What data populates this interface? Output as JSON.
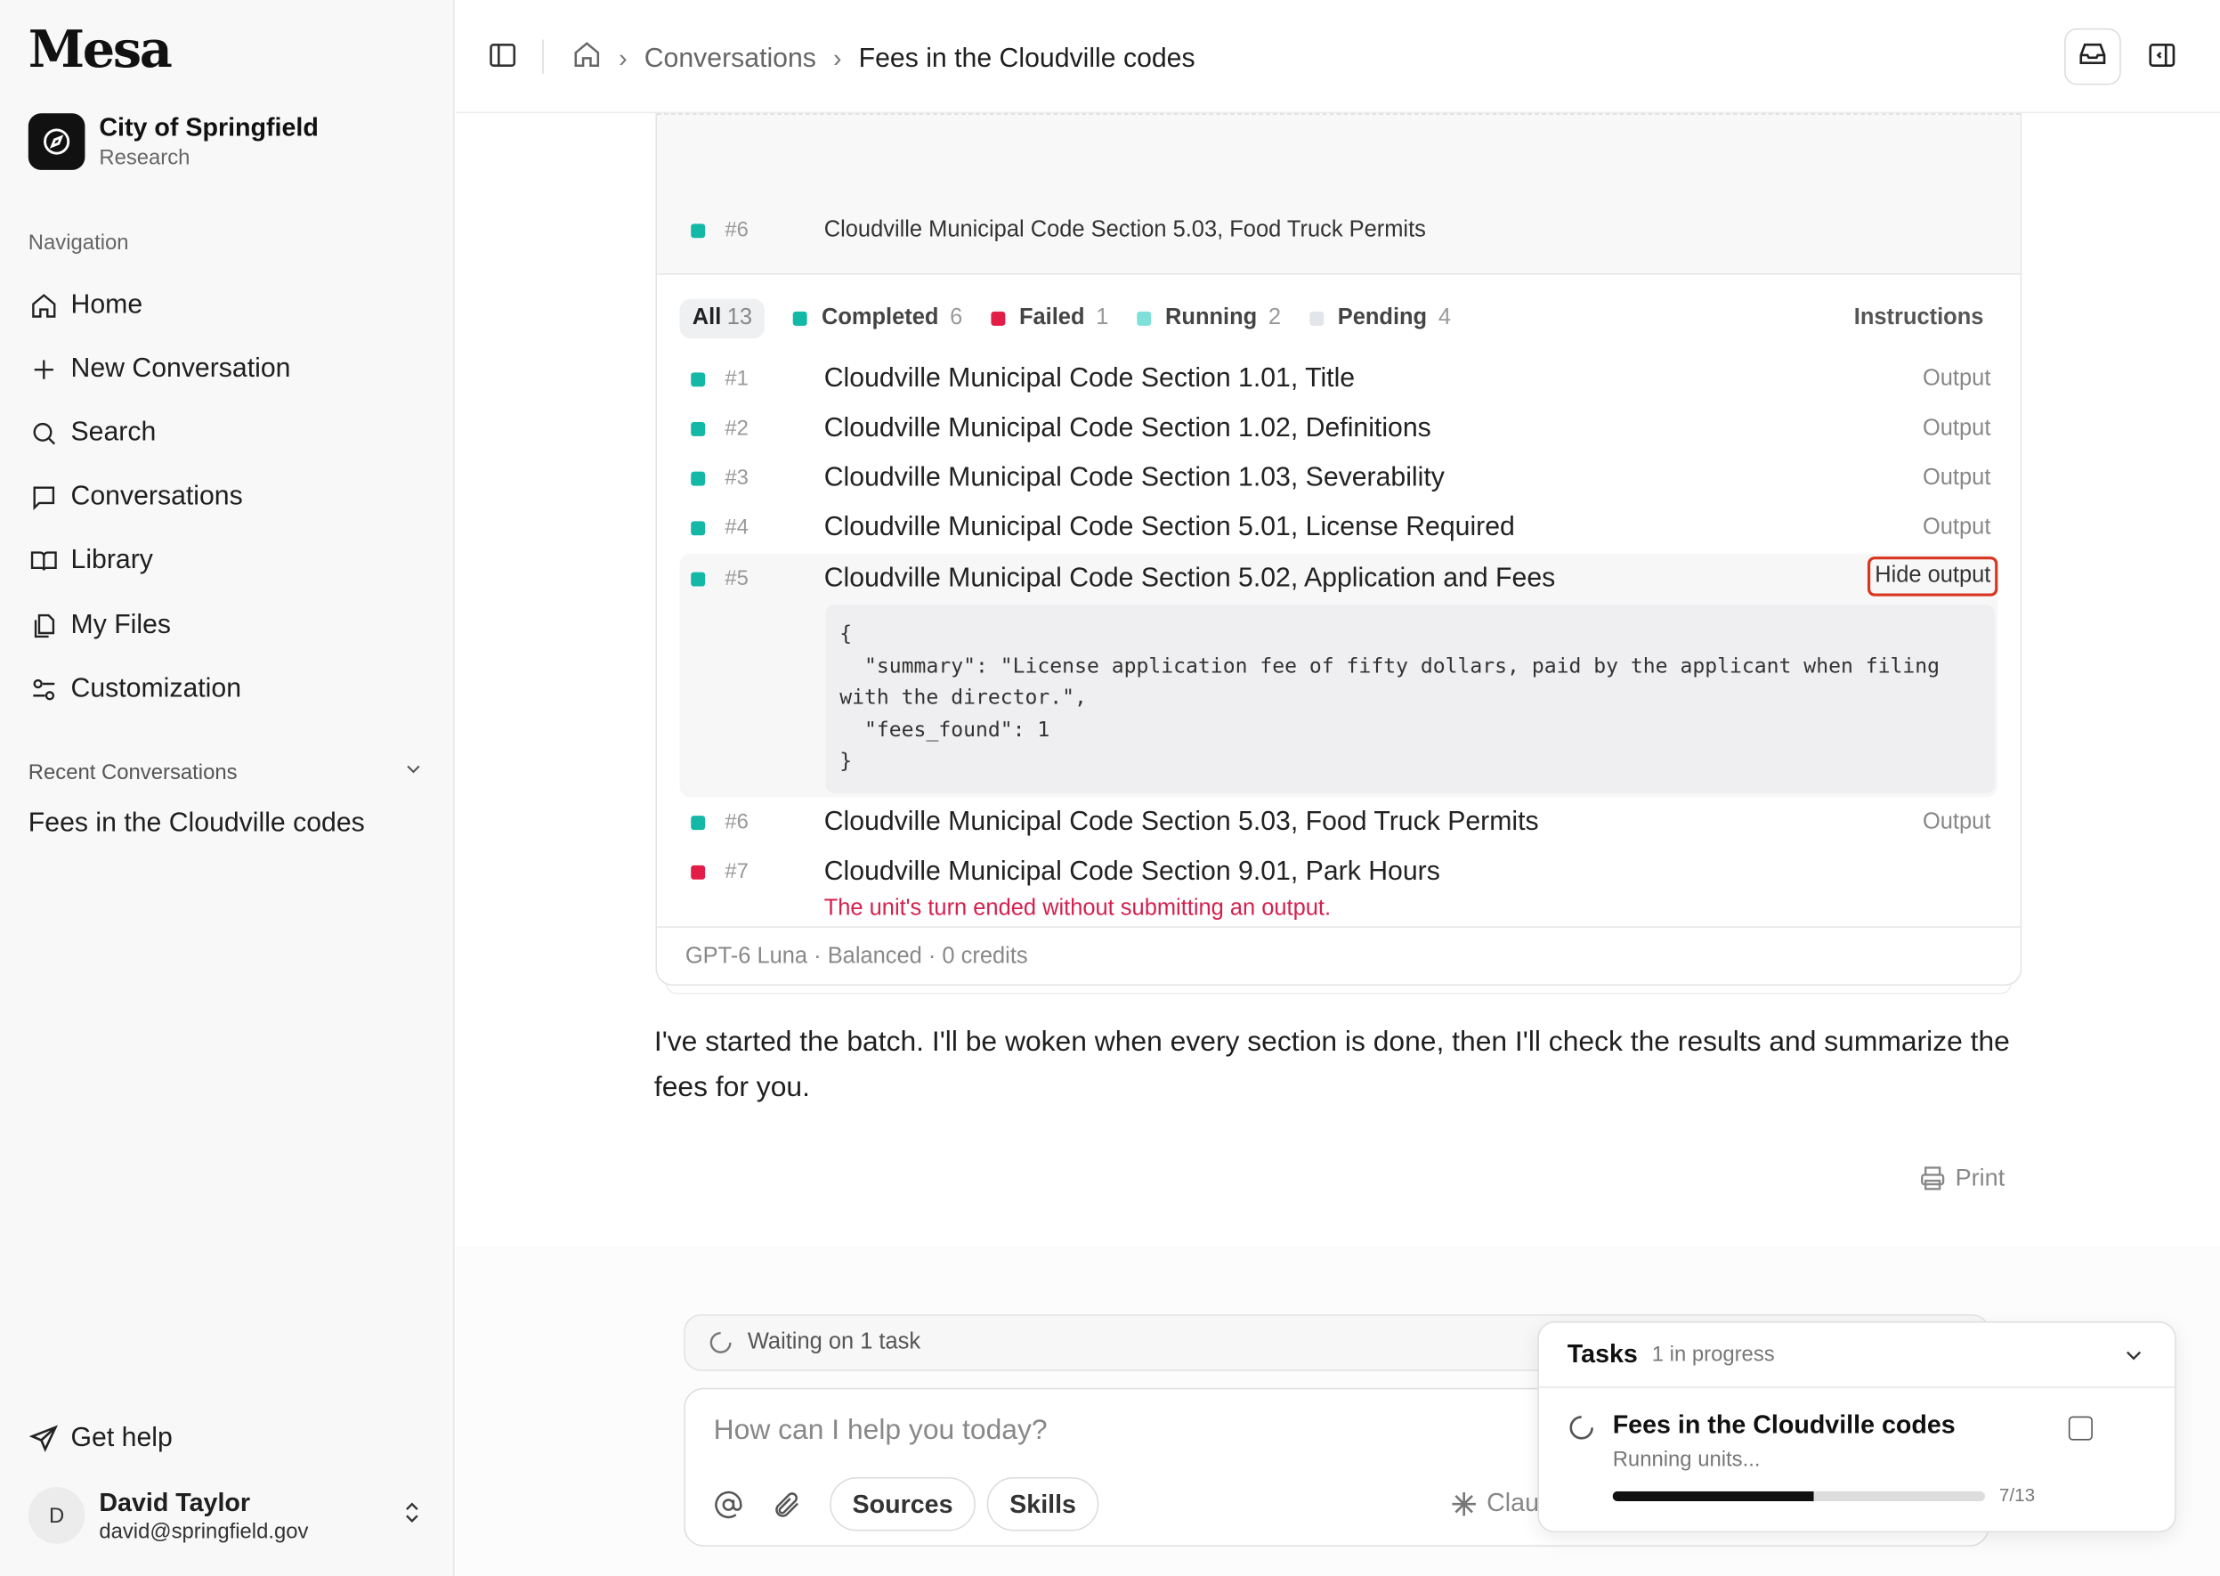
{
  "app": {
    "brand": "Mesa"
  },
  "org": {
    "name": "City of Springfield",
    "subtitle": "Research"
  },
  "sidebar": {
    "nav_label": "Navigation",
    "items": [
      {
        "label": "Home",
        "icon": "home-icon"
      },
      {
        "label": "New Conversation",
        "icon": "plus-icon"
      },
      {
        "label": "Search",
        "icon": "search-icon"
      },
      {
        "label": "Conversations",
        "icon": "chat-icon"
      },
      {
        "label": "Library",
        "icon": "book-icon"
      },
      {
        "label": "My Files",
        "icon": "files-icon"
      },
      {
        "label": "Customization",
        "icon": "sliders-icon"
      }
    ],
    "recent_label": "Recent Conversations",
    "recent_items": [
      "Fees in the Cloudville codes"
    ],
    "help_label": "Get help"
  },
  "user": {
    "initial": "D",
    "name": "David Taylor",
    "email": "david@springfield.gov"
  },
  "breadcrumb": {
    "parent": "Conversations",
    "current": "Fees in the Cloudville codes"
  },
  "batch": {
    "head_row": {
      "num": "#6",
      "title": "Cloudville Municipal Code Section 5.03, Food Truck Permits",
      "status": "completed"
    },
    "filters": {
      "all_label": "All",
      "all_count": "13",
      "completed_label": "Completed",
      "completed_count": "6",
      "failed_label": "Failed",
      "failed_count": "1",
      "running_label": "Running",
      "running_count": "2",
      "pending_label": "Pending",
      "pending_count": "4",
      "instructions_label": "Instructions"
    },
    "rows": [
      {
        "num": "#1",
        "title": "Cloudville Municipal Code Section 1.01, Title",
        "action": "Output",
        "status": "completed"
      },
      {
        "num": "#2",
        "title": "Cloudville Municipal Code Section 1.02, Definitions",
        "action": "Output",
        "status": "completed"
      },
      {
        "num": "#3",
        "title": "Cloudville Municipal Code Section 1.03, Severability",
        "action": "Output",
        "status": "completed"
      },
      {
        "num": "#4",
        "title": "Cloudville Municipal Code Section 5.01, License Required",
        "action": "Output",
        "status": "completed"
      },
      {
        "num": "#5",
        "title": "Cloudville Municipal Code Section 5.02, Application and Fees",
        "action": "Hide output",
        "status": "completed"
      },
      {
        "num": "#6",
        "title": "Cloudville Municipal Code Section 5.03, Food Truck Permits",
        "action": "Output",
        "status": "completed"
      },
      {
        "num": "#7",
        "title": "Cloudville Municipal Code Section 9.01, Park Hours",
        "action": "",
        "status": "failed"
      }
    ],
    "output_json": "{\n  \"summary\": \"License application fee of fifty dollars, paid by the applicant when filing with the director.\",\n  \"fees_found\": 1\n}",
    "error_text": "The unit's turn ended without submitting an output.",
    "footer": "GPT-6 Luna · Balanced · 0 credits"
  },
  "status_colors": {
    "completed": "#14b8a6",
    "failed": "#e11d48",
    "running": "#7ee0d8",
    "pending": "#e2e6ea"
  },
  "assistant_message": "I've started the batch. I'll be woken when every section is done, then I'll check the results and summarize the fees for you.",
  "print_label": "Print",
  "composer": {
    "waiting_text": "Waiting on 1 task",
    "placeholder": "How can I help you today?",
    "sources_label": "Sources",
    "skills_label": "Skills",
    "model_label": "Clau"
  },
  "tasks": {
    "title": "Tasks",
    "subtitle": "1 in progress",
    "task_name": "Fees in the Cloudville codes",
    "task_status": "Running units...",
    "progress_text": "7/13",
    "progress_fraction": 0.54
  }
}
